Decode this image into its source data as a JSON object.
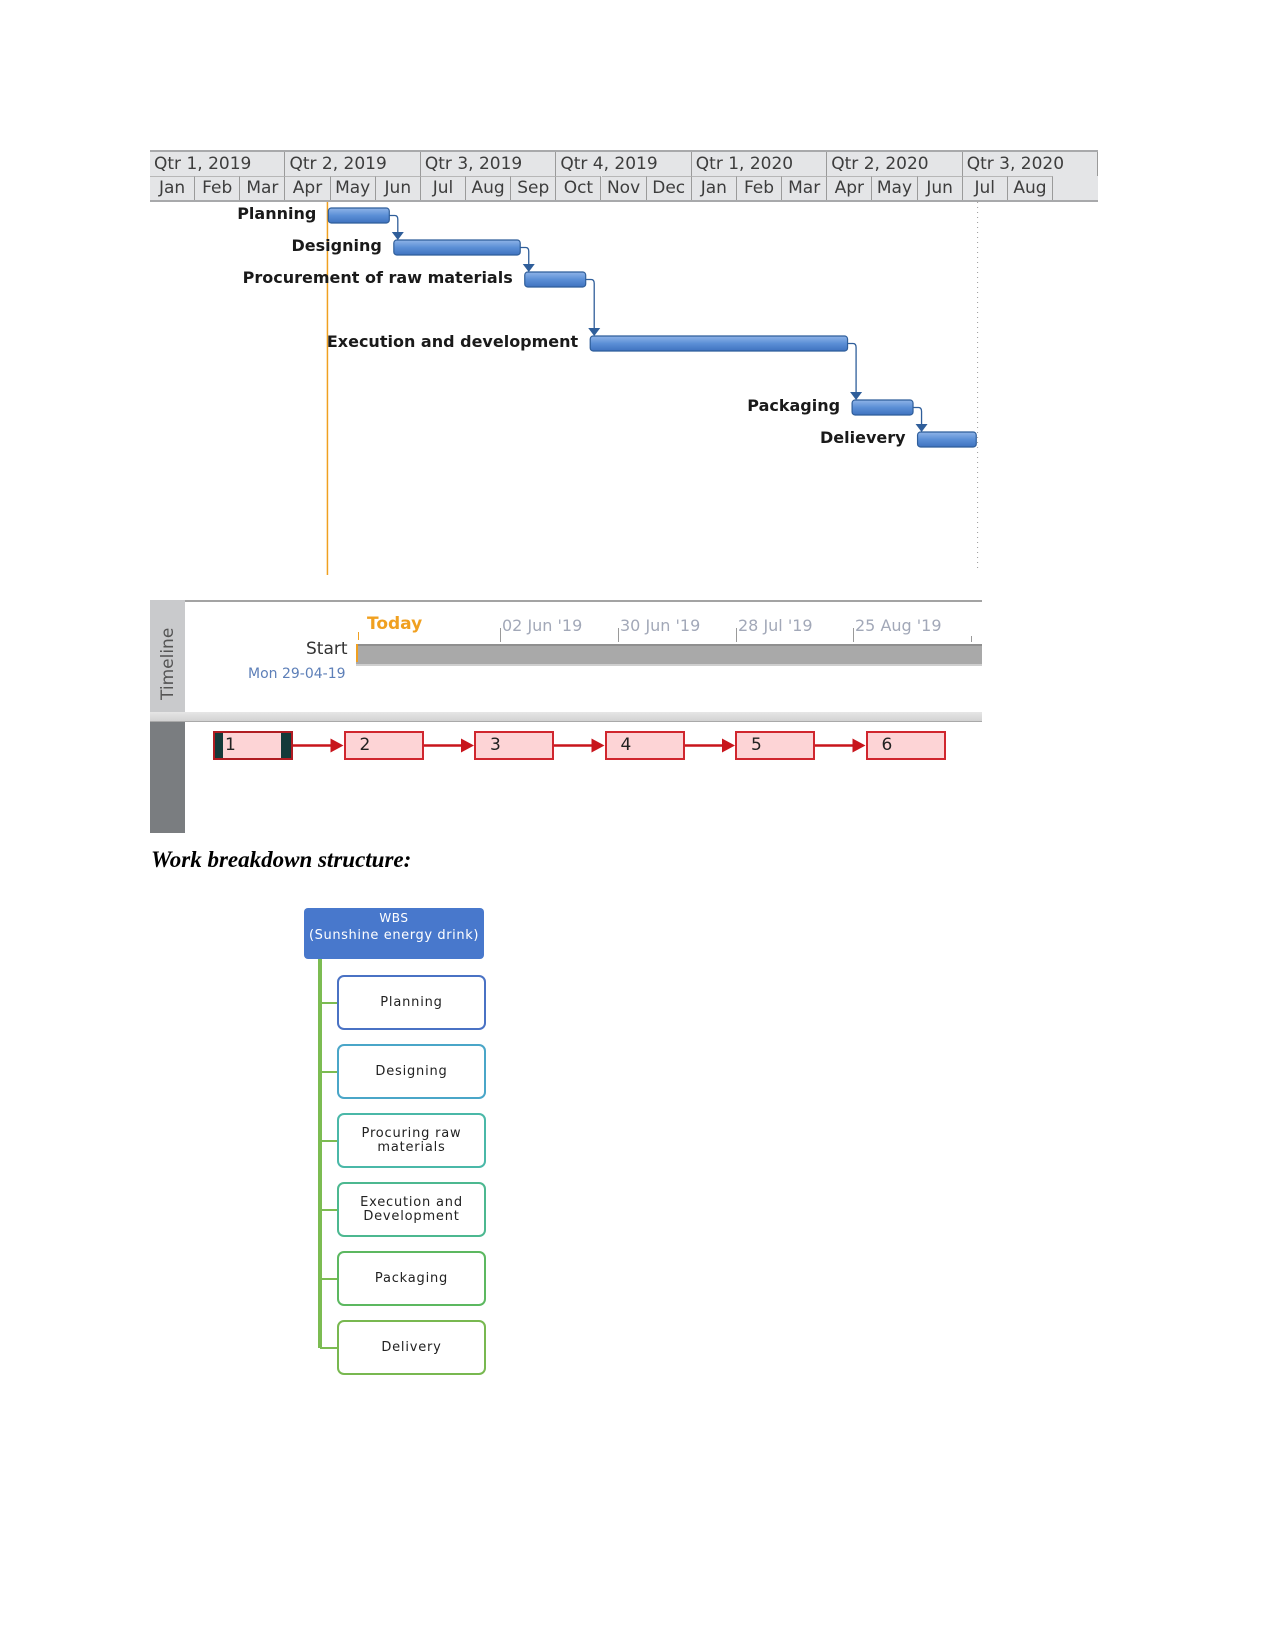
{
  "gantt": {
    "quarters": [
      "Qtr 1, 2019",
      "Qtr 2, 2019",
      "Qtr 3, 2019",
      "Qtr 4, 2019",
      "Qtr 1, 2020",
      "Qtr 2, 2020",
      "Qtr 3, 2020"
    ],
    "months": [
      "Jan",
      "Feb",
      "Mar",
      "Apr",
      "May",
      "Jun",
      "Jul",
      "Aug",
      "Sep",
      "Oct",
      "Nov",
      "Dec",
      "Jan",
      "Feb",
      "Mar",
      "Apr",
      "May",
      "Jun",
      "Jul",
      "Aug"
    ],
    "axis_start": "2019-01-01",
    "today_marker_date": "2019-04-29",
    "project_end_marker_date": "2020-07-01",
    "bar_color": "#5b8fd6",
    "link_color": "#2f5e9a",
    "today_color": "#f0a020",
    "tasks": [
      {
        "name": "Planning",
        "start_month": 3.95,
        "end_month": 5.3,
        "row": 0
      },
      {
        "name": "Designing",
        "start_month": 5.4,
        "end_month": 8.2,
        "row": 1
      },
      {
        "name": "Procurement of raw materials",
        "start_month": 8.3,
        "end_month": 9.65,
        "row": 2
      },
      {
        "name": "Execution and development",
        "start_month": 9.75,
        "end_month": 15.45,
        "row": 4
      },
      {
        "name": "Packaging",
        "start_month": 15.55,
        "end_month": 16.9,
        "row": 6
      },
      {
        "name": "Delievery",
        "start_month": 17.0,
        "end_month": 18.3,
        "row": 7
      }
    ]
  },
  "timeline": {
    "tab_label": "Timeline",
    "today_label": "Today",
    "start_label": "Start",
    "start_date": "Mon 29-04-19",
    "dates": [
      "02 Jun '19",
      "30 Jun '19",
      "28 Jul '19",
      "25 Aug '19"
    ]
  },
  "network": {
    "nodes": [
      "1",
      "2",
      "3",
      "4",
      "5",
      "6"
    ],
    "selected": "1"
  },
  "wbs": {
    "heading": "Work breakdown structure:",
    "root_line1": "WBS",
    "root_line2": "(Sunshine energy drink)",
    "items": [
      {
        "label": "Planning",
        "color": "#4a72c4"
      },
      {
        "label": "Designing",
        "color": "#4aa6c8"
      },
      {
        "label": "Procuring raw materials",
        "color": "#4ab8a8"
      },
      {
        "label": "Execution and Development",
        "color": "#4cb890"
      },
      {
        "label": "Packaging",
        "color": "#5cb860"
      },
      {
        "label": "Delivery",
        "color": "#78b850"
      }
    ]
  }
}
